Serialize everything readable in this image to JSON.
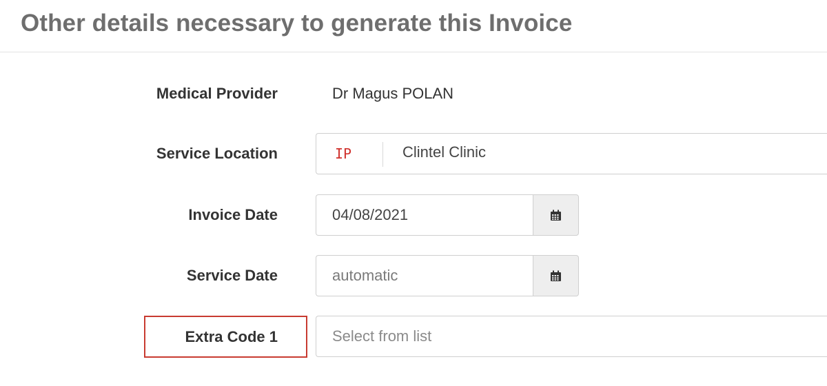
{
  "section": {
    "title": "Other details necessary to generate this Invoice"
  },
  "form": {
    "medical_provider": {
      "label": "Medical Provider",
      "value": "Dr Magus POLAN"
    },
    "service_location": {
      "label": "Service Location",
      "code": "IP",
      "name": "Clintel Clinic"
    },
    "invoice_date": {
      "label": "Invoice Date",
      "value": "04/08/2021",
      "icon": "calendar-icon"
    },
    "service_date": {
      "label": "Service Date",
      "placeholder": "automatic",
      "icon": "calendar-icon"
    },
    "extra_code_1": {
      "label": "Extra Code 1",
      "placeholder": "Select from list",
      "highlighted": true
    }
  },
  "colors": {
    "title": "#6e6e6e",
    "location_code": "#d0312d",
    "highlight_border": "#c83a30",
    "button_bg": "#eeeeee"
  }
}
